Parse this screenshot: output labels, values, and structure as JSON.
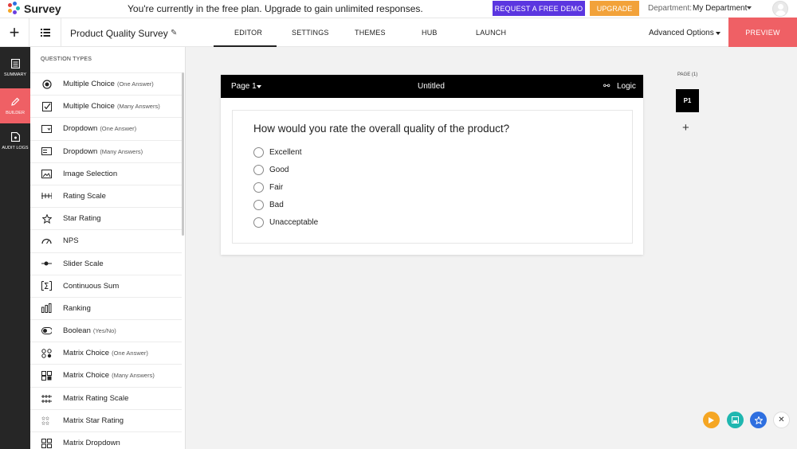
{
  "app": {
    "name": "Survey",
    "plan_message": "You're currently in the free plan. Upgrade to gain unlimited responses.",
    "demo_label": "REQUEST A FREE DEMO",
    "upgrade_label": "UPGRADE",
    "department_label": "Department:",
    "department_value": "My Department"
  },
  "colors": {
    "demo": "#5b36e0",
    "upgrade": "#f2a23a",
    "preview": "#ef6065",
    "active_nav": "#ef6065"
  },
  "navbar": {
    "survey_title": "Product Quality Survey",
    "tabs": [
      "EDITOR",
      "SETTINGS",
      "THEMES",
      "HUB",
      "LAUNCH"
    ],
    "active_tab": "EDITOR",
    "advanced_label": "Advanced Options",
    "preview_label": "PREVIEW"
  },
  "leftnav": [
    {
      "label": "SUMMARY",
      "icon": "document-icon"
    },
    {
      "label": "BUILDER",
      "icon": "pencil-icon",
      "active": true
    },
    {
      "label": "AUDIT LOGS",
      "icon": "file-icon"
    }
  ],
  "question_panel": {
    "heading": "QUESTION TYPES",
    "items": [
      {
        "label": "Multiple Choice",
        "sub": "(One Answer)",
        "icon": "radio-icon"
      },
      {
        "label": "Multiple Choice",
        "sub": "(Many Answers)",
        "icon": "checkbox-icon"
      },
      {
        "label": "Dropdown",
        "sub": "(One Answer)",
        "icon": "dropdown-icon"
      },
      {
        "label": "Dropdown",
        "sub": "(Many Answers)",
        "icon": "dropdown-multi-icon"
      },
      {
        "label": "Image Selection",
        "sub": "",
        "icon": "image-icon"
      },
      {
        "label": "Rating Scale",
        "sub": "",
        "icon": "rating-scale-icon"
      },
      {
        "label": "Star Rating",
        "sub": "",
        "icon": "star-icon"
      },
      {
        "label": "NPS",
        "sub": "",
        "icon": "gauge-icon"
      },
      {
        "label": "Slider Scale",
        "sub": "",
        "icon": "slider-icon"
      },
      {
        "label": "Continuous Sum",
        "sub": "",
        "icon": "sum-icon"
      },
      {
        "label": "Ranking",
        "sub": "",
        "icon": "ranking-icon"
      },
      {
        "label": "Boolean",
        "sub": "(Yes/No)",
        "icon": "toggle-icon"
      },
      {
        "label": "Matrix Choice",
        "sub": "(One Answer)",
        "icon": "matrix-icon"
      },
      {
        "label": "Matrix Choice",
        "sub": "(Many Answers)",
        "icon": "matrix-multi-icon"
      },
      {
        "label": "Matrix Rating Scale",
        "sub": "",
        "icon": "matrix-rating-icon"
      },
      {
        "label": "Matrix Star Rating",
        "sub": "",
        "icon": "matrix-star-icon"
      },
      {
        "label": "Matrix Dropdown",
        "sub": "",
        "icon": "matrix-dropdown-icon"
      }
    ]
  },
  "card": {
    "page_label": "Page 1",
    "title": "Untitled",
    "logic_label": "Logic",
    "question": "How would you rate the overall quality of the product?",
    "options": [
      "Excellent",
      "Good",
      "Fair",
      "Bad",
      "Unacceptable"
    ]
  },
  "pages": {
    "label": "PAGE (1)",
    "chip": "P1",
    "add": "+"
  },
  "fabs": [
    {
      "name": "play-icon",
      "color": "#f5a623"
    },
    {
      "name": "save-icon",
      "color": "#1fb7b0"
    },
    {
      "name": "star-icon",
      "color": "#2e6fe0"
    }
  ]
}
